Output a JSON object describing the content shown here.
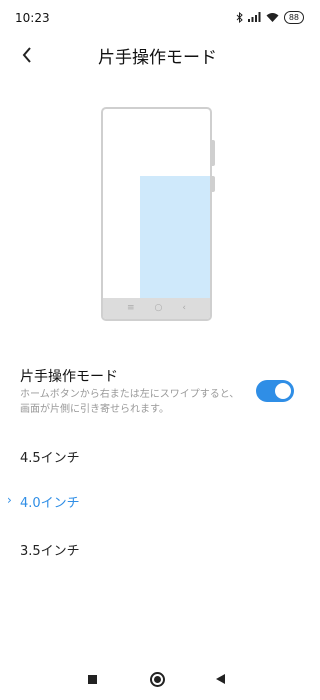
{
  "status_bar": {
    "time": "10:23",
    "battery": "88",
    "icons": [
      "bluetooth-icon",
      "signal-icon",
      "wifi-icon",
      "battery-icon"
    ]
  },
  "header": {
    "back_icon": "chevron-left-icon",
    "title": "片手操作モード"
  },
  "illustration": {
    "reduced_screen_color": "#cfe9fb",
    "frame_color": "#cfcfcf"
  },
  "one_handed_mode": {
    "title": "片手操作モード",
    "description": "ホームボタンから右または左にスワイプすると、画面が片側に引き寄せられます。",
    "enabled": true,
    "accent_color": "#2f8ee6"
  },
  "size_options": [
    {
      "label": "4.5インチ",
      "selected": false
    },
    {
      "label": "4.0インチ",
      "selected": true
    },
    {
      "label": "3.5インチ",
      "selected": false
    }
  ],
  "selected_marker": "›",
  "bottom_nav": [
    "recents-square-icon",
    "home-circle-icon",
    "back-triangle-icon"
  ]
}
